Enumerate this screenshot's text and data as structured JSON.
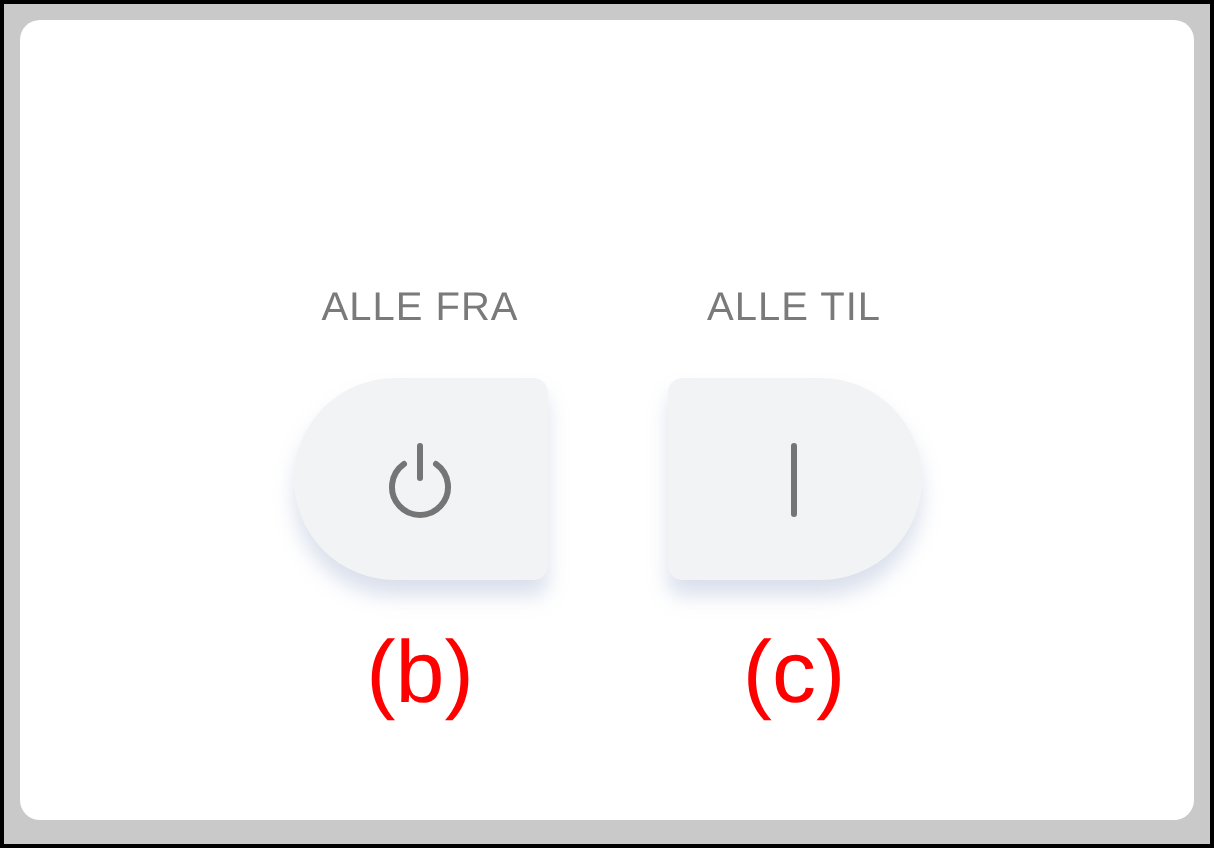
{
  "switches": [
    {
      "label": "ALLE FRA",
      "kind": "off",
      "annotation": "(b)"
    },
    {
      "label": "ALLE TIL",
      "kind": "on",
      "annotation": "(c)"
    }
  ]
}
